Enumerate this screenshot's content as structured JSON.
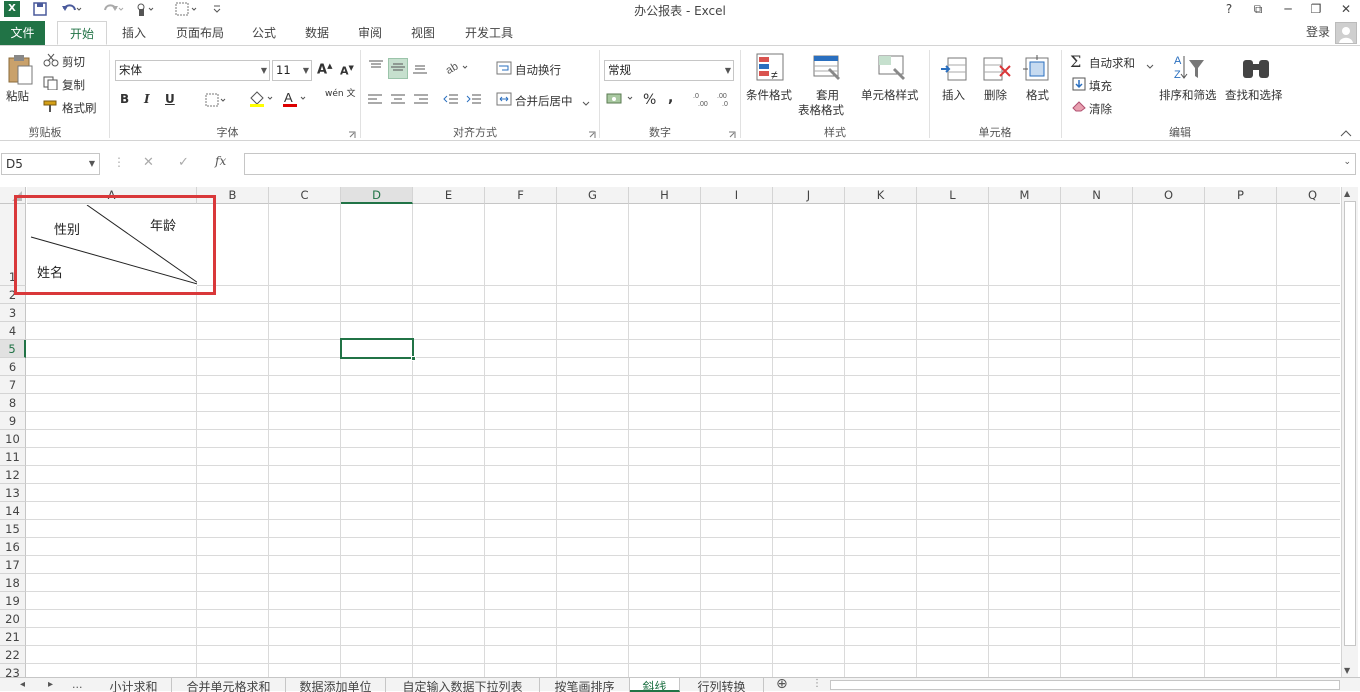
{
  "window": {
    "title": "办公报表 - Excel",
    "help": "?",
    "minimize": "─",
    "restore": "❐",
    "close": "✕",
    "ribbon_display": "⧉"
  },
  "quick_access": {
    "save_icon": "save-icon",
    "undo_icon": "undo-icon",
    "redo_icon": "redo-icon",
    "touch_icon": "touch-mode-icon",
    "border_icon": "border-icon",
    "customize": "customize-icon"
  },
  "tabs": [
    "文件",
    "开始",
    "插入",
    "页面布局",
    "公式",
    "数据",
    "审阅",
    "视图",
    "开发工具"
  ],
  "active_tab": "开始",
  "signin": "登录",
  "clipboard": {
    "paste": "粘贴",
    "cut": "剪切",
    "copy": "复制",
    "format_painter": "格式刷",
    "label": "剪贴板"
  },
  "font": {
    "name": "宋体",
    "size": "11",
    "bold": "B",
    "italic": "I",
    "underline": "U",
    "phonetic": "wén 文",
    "label": "字体"
  },
  "alignment": {
    "wrap": "自动换行",
    "merge": "合并后居中",
    "label": "对齐方式"
  },
  "number": {
    "format": "常规",
    "percent": "%",
    "comma": ",",
    "label": "数字"
  },
  "styles": {
    "conditional": "条件格式",
    "table_1": "套用",
    "table_2": "表格格式",
    "cell_styles": "单元格样式",
    "label": "样式"
  },
  "cells": {
    "insert": "插入",
    "delete": "删除",
    "format": "格式",
    "label": "单元格"
  },
  "editing": {
    "autosum": "自动求和",
    "fill": "填充",
    "clear": "清除",
    "sort": "排序和筛选",
    "find": "查找和选择",
    "label": "编辑"
  },
  "formula_bar": {
    "name_box": "D5",
    "cancel": "✕",
    "enter": "✓",
    "fx": "fx",
    "value": ""
  },
  "columns": [
    "A",
    "B",
    "C",
    "D",
    "E",
    "F",
    "G",
    "H",
    "I",
    "J",
    "K",
    "L",
    "M",
    "N",
    "O",
    "P",
    "Q"
  ],
  "rows": [
    "1",
    "2",
    "3",
    "4",
    "5",
    "6",
    "7",
    "8",
    "9",
    "10",
    "11",
    "12",
    "13",
    "14",
    "15",
    "16",
    "17",
    "18",
    "19",
    "20",
    "21",
    "22",
    "23"
  ],
  "selected_cell": "D5",
  "cell_a1": {
    "text_gender": "性别",
    "text_age": "年龄",
    "text_name": "姓名"
  },
  "highlight_color": "#d9383a",
  "accent": "#217346",
  "sheets": [
    "小计求和",
    "合并单元格求和",
    "数据添加单位",
    "自定输入数据下拉列表",
    "按笔画排序",
    "斜线",
    "行列转换"
  ],
  "active_sheet": "斜线",
  "sheet_nav": {
    "prev": "◂",
    "next": "▸",
    "more": "...",
    "add": "⊕"
  }
}
